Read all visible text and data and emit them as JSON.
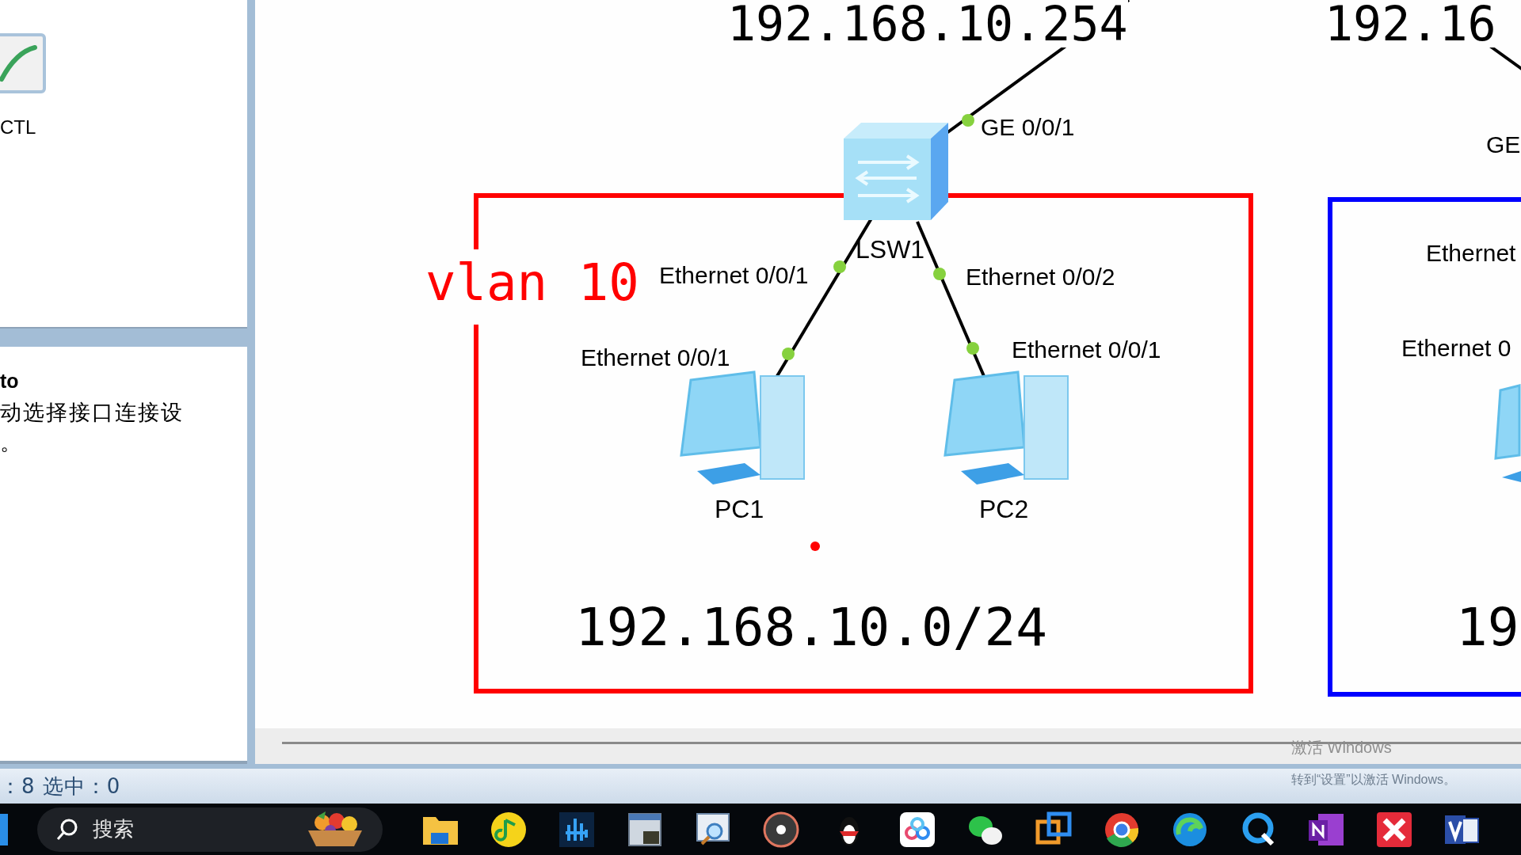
{
  "left_panel": {
    "device_label": "CTL",
    "tip": {
      "title": "to",
      "lines": [
        "动选择接口连接设",
        "。"
      ]
    }
  },
  "canvas": {
    "addresses": [
      "192.168.10.254",
      "192.16"
    ],
    "areas": [
      {
        "label": "vlan 10",
        "subnet": "192.168.10.0/24",
        "color": "#ff0000"
      },
      {
        "subnet": "19",
        "color": "#0000ff"
      }
    ],
    "devices": [
      {
        "kind": "switch",
        "name": "LSW1"
      },
      {
        "kind": "pc",
        "name": "PC1"
      },
      {
        "kind": "pc",
        "name": "PC2"
      },
      {
        "kind": "pc"
      }
    ],
    "port_labels": [
      "GE 0/0/1",
      "GE",
      "Ethernet 0/0/1",
      "Ethernet 0/0/2",
      "Ethernet 0/0/1",
      "Ethernet 0/0/1",
      "Ethernet",
      "Ethernet 0"
    ]
  },
  "status_bar": "：8 选中：0",
  "activation_notice": [
    "激活 Windows",
    "转到“设置”以激活 Windows。"
  ],
  "taskbar": {
    "search": {
      "placeholder": "搜索"
    }
  }
}
